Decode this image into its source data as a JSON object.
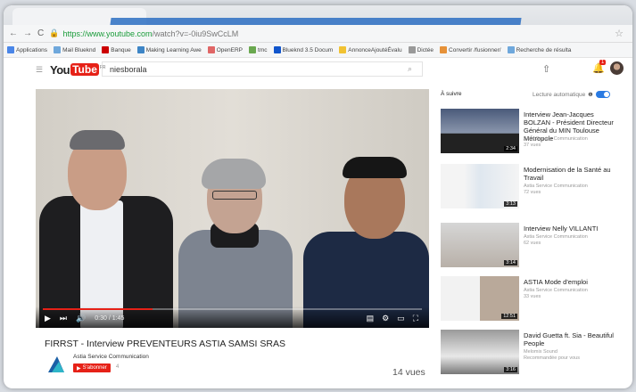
{
  "browser": {
    "url_secure": "https://www.youtube.com",
    "url_rest": "/watch?v=-0iu9SwCcLM"
  },
  "bookmarks": [
    {
      "label": "Applications",
      "color": "#4a86e8"
    },
    {
      "label": "Mail Blueknd",
      "color": "#6fa8dc"
    },
    {
      "label": "Banque",
      "color": "#cc0000"
    },
    {
      "label": "Making Learning Awe",
      "color": "#3d85c6"
    },
    {
      "label": "OpenERP",
      "color": "#e06666"
    },
    {
      "label": "tmc",
      "color": "#6aa84f"
    },
    {
      "label": "Blueknd 3.5 Docum",
      "color": "#1155cc"
    },
    {
      "label": "AnnonceAjoutéÉvalu",
      "color": "#f1c232"
    },
    {
      "label": "Dictée",
      "color": "#999999"
    },
    {
      "label": "Convertir /fusionner/",
      "color": "#e69138"
    },
    {
      "label": "Recherche de résulta",
      "color": "#6fa8dc"
    }
  ],
  "header": {
    "logo_you": "You",
    "logo_tube": "Tube",
    "logo_region": "FR",
    "search_value": "niesborala",
    "notif_count": "1"
  },
  "player": {
    "time": "0:30 / 1:45",
    "progress": 0.29
  },
  "video": {
    "title": "FIRRST - Interview PREVENTEURS ASTIA SAMSI SRAS",
    "channel": "Astia Service Communication",
    "subscribe": "S'abonner",
    "subscribers": "4",
    "views": "14 vues"
  },
  "sidebar": {
    "up_next": "À suivre",
    "autoplay": "Lecture automatique",
    "items": [
      {
        "title": "Interview Jean-Jacques BOLZAN - Président Directeur Général du MIN Toulouse Métropole",
        "channel": "Astia Service Communication",
        "views": "37 vues",
        "duration": "2:34"
      },
      {
        "title": "Modernisation de la Santé au Travail",
        "channel": "Astia Service Communication",
        "views": "72 vues",
        "duration": "3:13"
      },
      {
        "title": "Interview Nelly VILLANTI",
        "channel": "Astia Service Communication",
        "views": "62 vues",
        "duration": "3:14"
      },
      {
        "title": "ASTIA Mode d'emploi",
        "channel": "Astia Service Communication",
        "views": "33 vues",
        "duration": "12:51"
      },
      {
        "title": "David Guetta ft. Sia - Beautiful People",
        "channel": "Melomix Sound",
        "views": "Recommandée pour vous",
        "duration": "3:16"
      }
    ]
  }
}
